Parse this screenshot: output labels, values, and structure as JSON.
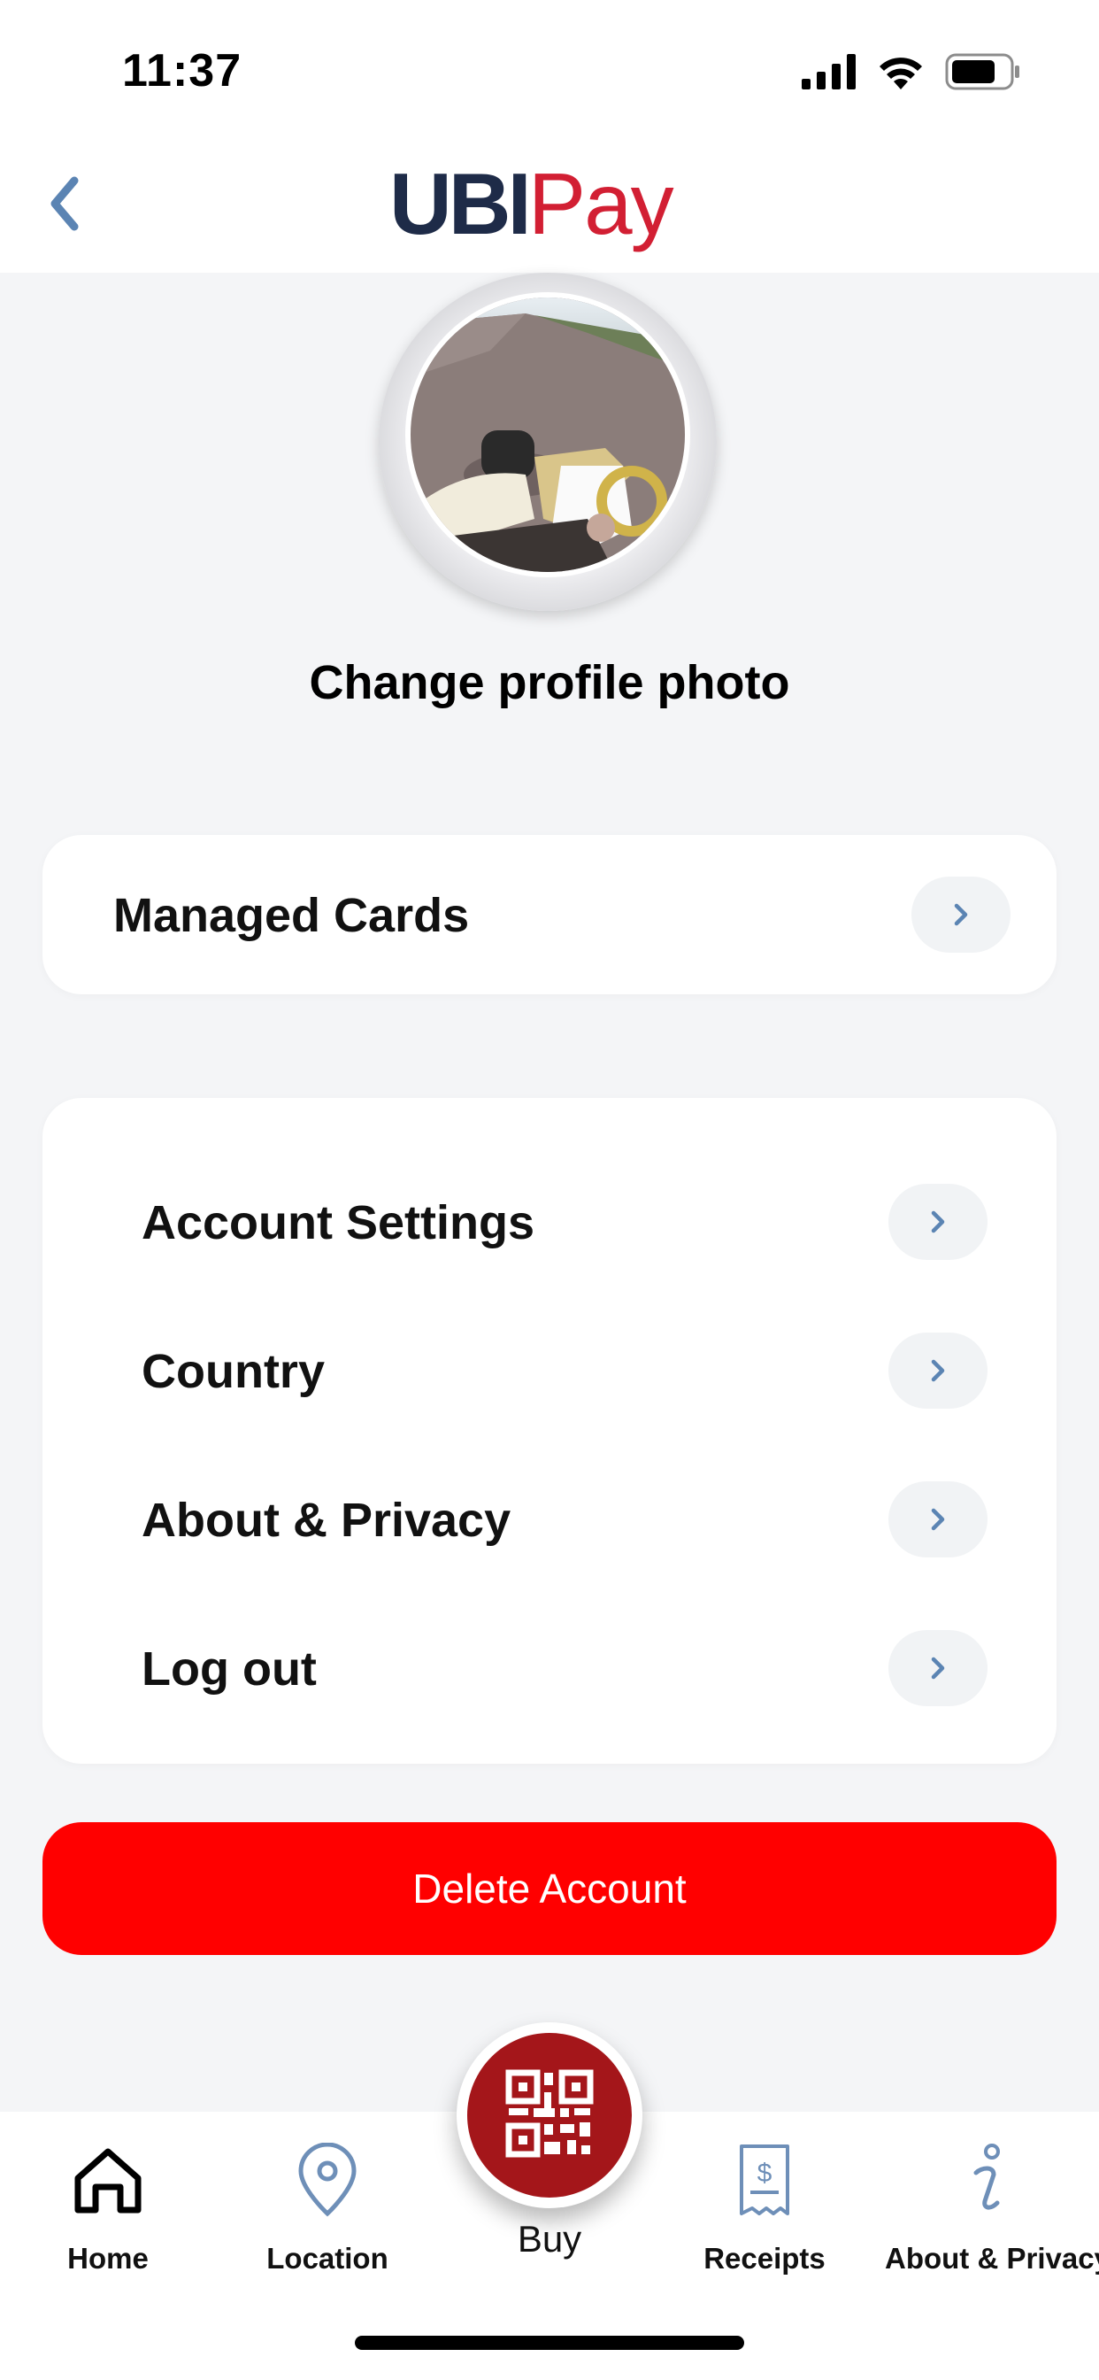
{
  "status_bar": {
    "time": "11:37",
    "icons": [
      "cellular-signal-icon",
      "wifi-icon",
      "battery-icon"
    ]
  },
  "header": {
    "back_icon": "chevron-left-icon",
    "logo_part1": "UBI",
    "logo_part2": "Pay",
    "logo_colors": {
      "ubi": "#1e2b48",
      "pay": "#d21f33"
    }
  },
  "profile": {
    "change_photo_label": "Change profile photo"
  },
  "managed_cards": {
    "label": "Managed Cards"
  },
  "menu": {
    "items": [
      {
        "label": "Account Settings"
      },
      {
        "label": "Country"
      },
      {
        "label": "About & Privacy"
      },
      {
        "label": "Log out"
      }
    ]
  },
  "delete_button": {
    "label": "Delete Account",
    "color": "#ff0000"
  },
  "tabbar": {
    "tabs": [
      {
        "label": "Home",
        "icon": "home-icon"
      },
      {
        "label": "Location",
        "icon": "location-pin-icon"
      },
      {
        "label": "Buy",
        "icon": "qr-code-icon"
      },
      {
        "label": "Receipts",
        "icon": "receipt-icon"
      },
      {
        "label": "About & Privacy",
        "icon": "info-icon"
      }
    ],
    "buy_color": "#a4161a"
  },
  "colors": {
    "accent_chevron": "#5b84b3",
    "background": "#f4f5f7"
  }
}
